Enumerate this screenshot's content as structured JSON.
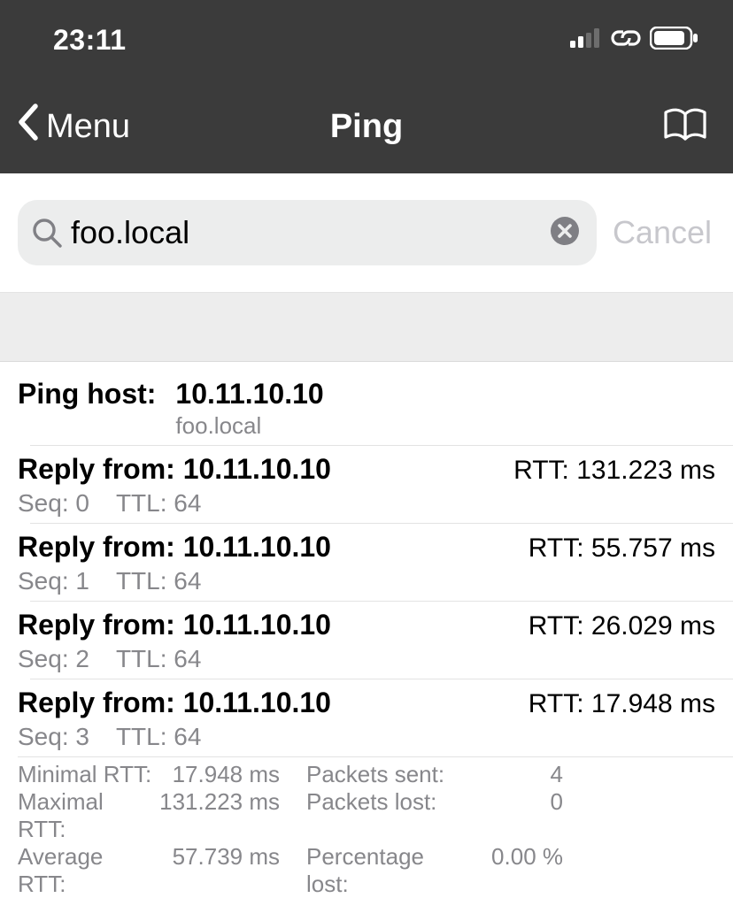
{
  "status": {
    "time": "23:11"
  },
  "nav": {
    "back_label": "Menu",
    "title": "Ping"
  },
  "search": {
    "value": "foo.local",
    "cancel": "Cancel"
  },
  "host": {
    "label": "Ping host:",
    "ip": "10.11.10.10",
    "name": "foo.local"
  },
  "replies": [
    {
      "prefix": "Reply from: ",
      "ip": "10.11.10.10",
      "rtt": "RTT: 131.223 ms",
      "seq": "Seq: 0",
      "ttl": "TTL: 64"
    },
    {
      "prefix": "Reply from: ",
      "ip": "10.11.10.10",
      "rtt": "RTT: 55.757 ms",
      "seq": "Seq: 1",
      "ttl": "TTL: 64"
    },
    {
      "prefix": "Reply from: ",
      "ip": "10.11.10.10",
      "rtt": "RTT: 26.029 ms",
      "seq": "Seq: 2",
      "ttl": "TTL: 64"
    },
    {
      "prefix": "Reply from: ",
      "ip": "10.11.10.10",
      "rtt": "RTT: 17.948 ms",
      "seq": "Seq: 3",
      "ttl": "TTL: 64"
    }
  ],
  "stats": {
    "min_label": "Minimal RTT:",
    "min_val": "17.948 ms",
    "max_label": "Maximal RTT:",
    "max_val": "131.223 ms",
    "avg_label": "Average RTT:",
    "avg_val": "57.739 ms",
    "sent_label": "Packets sent:",
    "sent_val": "4",
    "lost_label": "Packets lost:",
    "lost_val": "0",
    "pct_label": "Percentage lost:",
    "pct_val": "0.00 %"
  }
}
